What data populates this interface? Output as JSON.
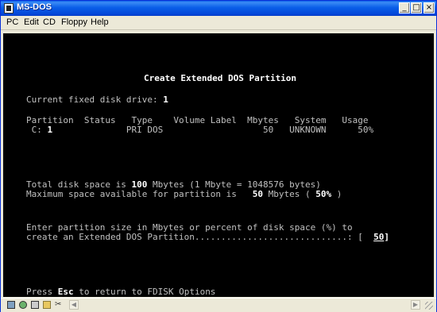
{
  "window": {
    "title": "MS-DOS",
    "controls": {
      "minimize": "_",
      "maximize": "□",
      "close": "×"
    }
  },
  "menu": {
    "items": [
      "PC",
      "Edit",
      "CD",
      "Floppy",
      "Help"
    ]
  },
  "console": {
    "heading": "Create Extended DOS Partition",
    "current_drive_label": "Current fixed disk drive:",
    "current_drive_value": "1",
    "table_header": "Partition  Status   Type    Volume Label  Mbytes   System   Usage",
    "table_rows": [
      {
        "partition": " C:",
        "num": "1",
        "rest": "              PRI DOS                   50   UNKNOWN      50%"
      }
    ],
    "total_label": "Total disk space is ",
    "total_value": "100",
    "total_rest": " Mbytes (1 Mbyte = 1048576 bytes)",
    "max_label": "Maximum space available for partition is   ",
    "max_value": "50",
    "max_rest": " Mbytes (",
    "max_pct": " 50%",
    "max_close": " )",
    "prompt_line1": "Enter partition size in Mbytes or percent of disk space (%) to",
    "prompt_line2": "create an Extended DOS Partition.............................: [",
    "input_value": "50",
    "input_close": "]",
    "footer_prefix": "Press ",
    "footer_key": "Esc",
    "footer_rest": " to return to FDISK Options"
  },
  "statusbar": {
    "icons": [
      "monitor-icon",
      "network-icon",
      "floppy-icon",
      "folder-icon",
      "scissors-icon"
    ],
    "scroll_left": "◀",
    "scroll_right": "▶"
  },
  "colors": {
    "console_bg": "#000000",
    "console_text": "#c0c0c0",
    "console_bright": "#ffffff",
    "titlebar": "#0a5ee8"
  }
}
